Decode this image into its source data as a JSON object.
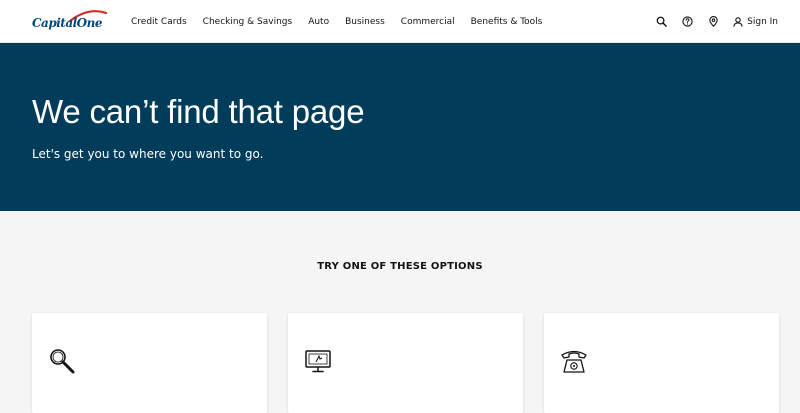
{
  "brand": {
    "logo_text": "CapitalOne",
    "accent_color": "#d03027",
    "navy_color": "#004879"
  },
  "nav": {
    "items": [
      {
        "label": "Credit Cards"
      },
      {
        "label": "Checking & Savings"
      },
      {
        "label": "Auto"
      },
      {
        "label": "Business"
      },
      {
        "label": "Commercial"
      },
      {
        "label": "Benefits & Tools"
      }
    ]
  },
  "utility": {
    "search_icon": "search-icon",
    "help_icon": "help-icon",
    "location_icon": "location-icon",
    "signin_label": "Sign In"
  },
  "hero": {
    "title": "We can’t find that page",
    "subtitle": "Let's get you to where you want to go.",
    "background_color": "#013d5b"
  },
  "options": {
    "title": "TRY ONE OF THESE OPTIONS",
    "cards": [
      {
        "icon": "magnifier-icon"
      },
      {
        "icon": "monitor-icon"
      },
      {
        "icon": "telephone-icon"
      }
    ]
  }
}
